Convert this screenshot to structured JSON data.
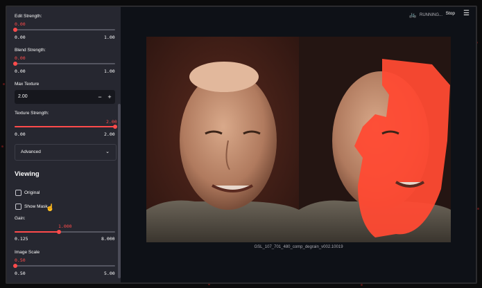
{
  "sidebar": {
    "edit_strength": {
      "label": "Edit Strength:",
      "value": "0.00",
      "min": "0.00",
      "max": "1.00",
      "fraction": 0
    },
    "blend_strength": {
      "label": "Blend Strength:",
      "value": "0.00",
      "min": "0.00",
      "max": "1.00",
      "fraction": 0
    },
    "max_texture": {
      "label": "Max Texture",
      "value": "2.00",
      "minus": "−",
      "plus": "+"
    },
    "texture_strength": {
      "label": "Texture Strength:",
      "value": "2.00",
      "min": "0.00",
      "max": "2.00",
      "fraction": 1
    },
    "advanced": {
      "label": "Advanced",
      "chevron": "⌄"
    },
    "viewing_heading": "Viewing",
    "original": {
      "label": "Original",
      "checked": false
    },
    "show_mask": {
      "label": "Show Mask",
      "checked": false
    },
    "gain": {
      "label": "Gain:",
      "value": "1.000",
      "min": "0.125",
      "max": "8.000",
      "fraction": 0.44
    },
    "image_scale": {
      "label": "Image Scale",
      "value": "0.50",
      "min": "0.50",
      "max": "5.00",
      "fraction": 0
    }
  },
  "topbar": {
    "status": "RUNNING...",
    "status_icon": "bike-icon",
    "stop_label": "Stop",
    "menu_icon": "hamburger-icon"
  },
  "viewer": {
    "caption": "GSL_107_701_480_comp_degrain_v002.10019"
  },
  "colors": {
    "accent": "#ff4b4b",
    "sidebar_bg": "#262730",
    "main_bg": "#0e1117",
    "mask_overlay": "#ff4a33"
  }
}
